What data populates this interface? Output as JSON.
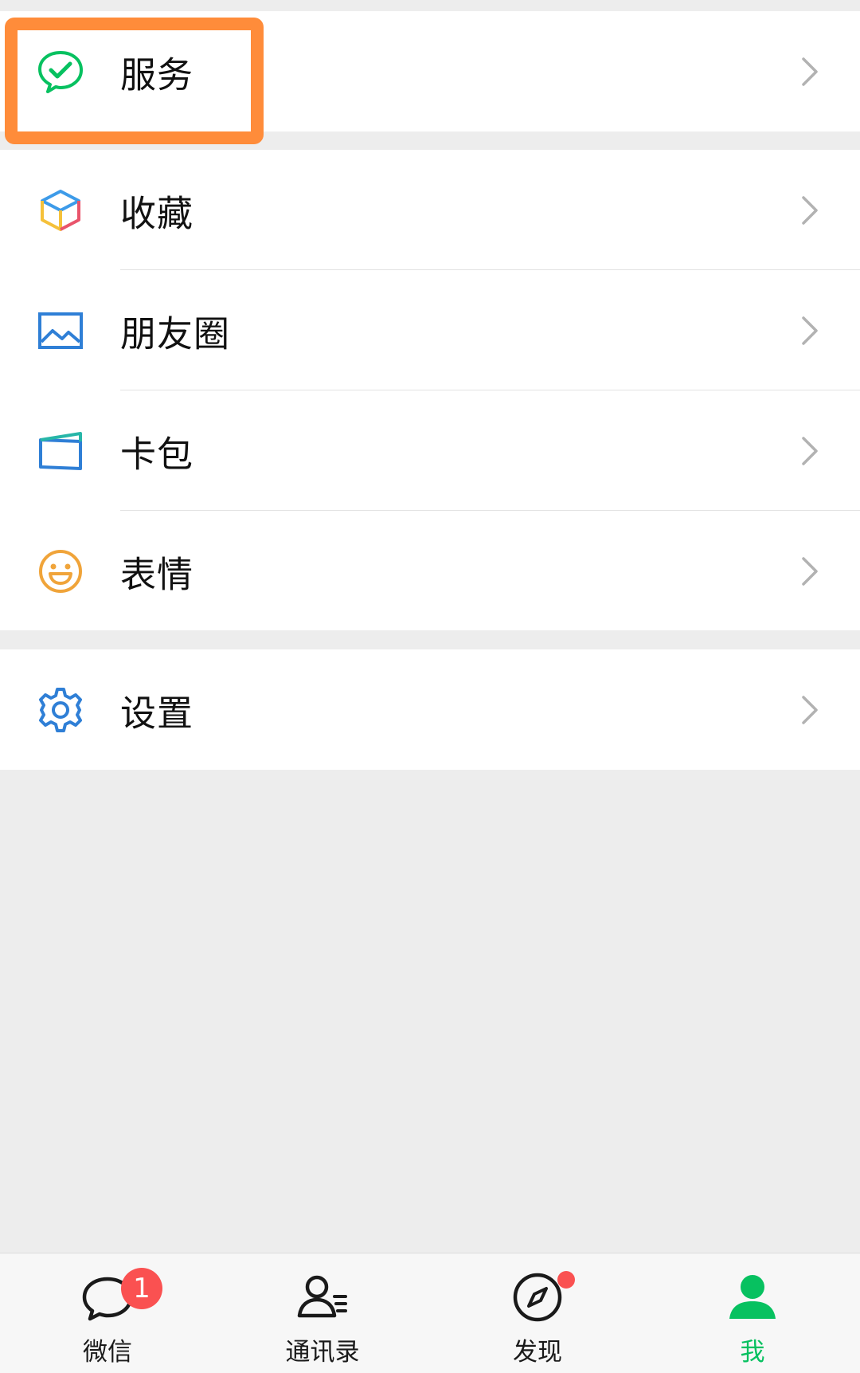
{
  "menu": {
    "services": {
      "label": "服务",
      "icon": "wechat-pay-check-icon"
    },
    "favorites": {
      "label": "收藏",
      "icon": "cube-icon"
    },
    "moments": {
      "label": "朋友圈",
      "icon": "photo-icon"
    },
    "cards": {
      "label": "卡包",
      "icon": "card-wallet-icon"
    },
    "stickers": {
      "label": "表情",
      "icon": "smiley-icon"
    },
    "settings": {
      "label": "设置",
      "icon": "gear-icon"
    }
  },
  "tabbar": {
    "tabs": [
      {
        "label": "微信",
        "icon": "chat-bubble-icon",
        "badge": "1"
      },
      {
        "label": "通讯录",
        "icon": "contacts-icon"
      },
      {
        "label": "发现",
        "icon": "compass-icon"
      },
      {
        "label": "我",
        "icon": "person-icon",
        "active": true
      }
    ]
  },
  "colors": {
    "accent": "#07c160",
    "highlight": "#ff8c3a",
    "badge": "#fa5151",
    "background": "#ededed"
  }
}
